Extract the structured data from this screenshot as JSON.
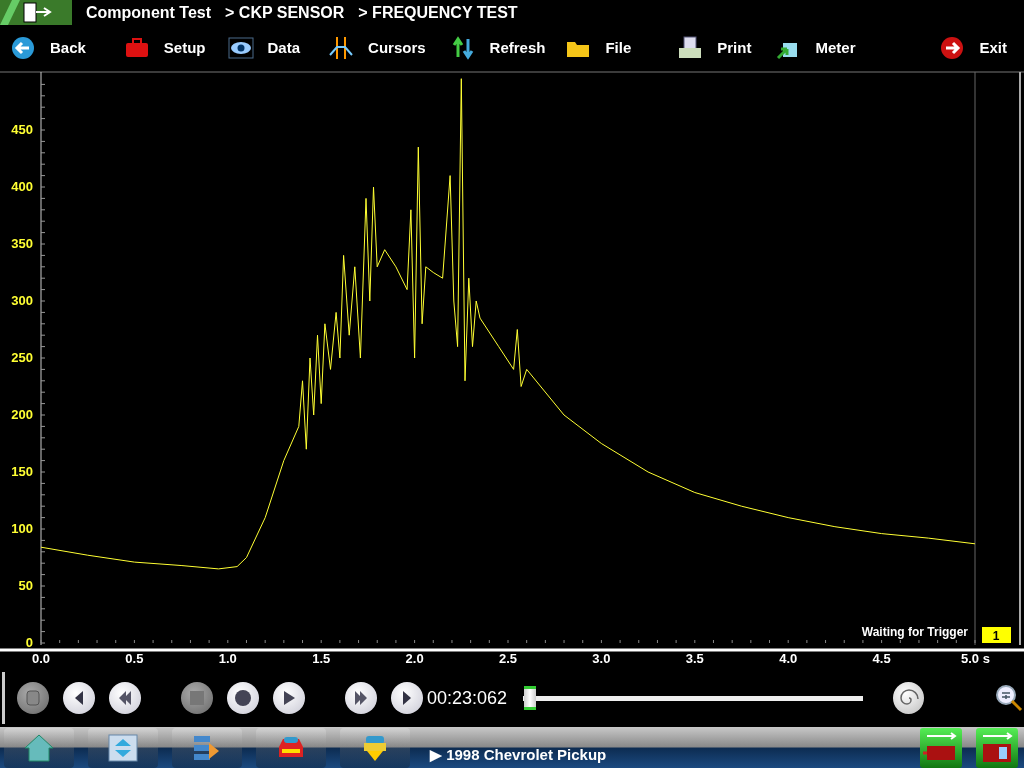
{
  "header": {
    "crumbs": [
      "Component Test",
      "> CKP SENSOR",
      "> FREQUENCY TEST"
    ]
  },
  "toolbar": [
    {
      "label": "Back"
    },
    {
      "label": "Setup"
    },
    {
      "label": "Data"
    },
    {
      "label": "Cursors"
    },
    {
      "label": "Refresh"
    },
    {
      "label": "File"
    },
    {
      "label": "Print"
    },
    {
      "label": "Meter"
    },
    {
      "label": "Exit"
    }
  ],
  "scope": {
    "status": "Waiting for Trigger",
    "channel": "1",
    "chart_data": {
      "type": "line",
      "xlim": [
        0,
        5
      ],
      "ylim": [
        0,
        500
      ],
      "xticks": [
        {
          "value": 0,
          "label": "0.0"
        },
        {
          "value": 0.5,
          "label": "0.5"
        },
        {
          "value": 1,
          "label": "1.0"
        },
        {
          "value": 1.5,
          "label": "1.5"
        },
        {
          "value": 2,
          "label": "2.0"
        },
        {
          "value": 2.5,
          "label": "2.5"
        },
        {
          "value": 3,
          "label": "3.0"
        },
        {
          "value": 3.5,
          "label": "3.5"
        },
        {
          "value": 4,
          "label": "4.0"
        },
        {
          "value": 4.5,
          "label": "4.5"
        },
        {
          "value": 5,
          "label": "5.0 s"
        }
      ],
      "yticks": [
        0,
        50,
        100,
        150,
        200,
        250,
        300,
        350,
        400,
        450
      ],
      "x": [
        0,
        0.25,
        0.5,
        0.75,
        0.95,
        1.05,
        1.1,
        1.2,
        1.3,
        1.38,
        1.4,
        1.42,
        1.44,
        1.46,
        1.48,
        1.5,
        1.52,
        1.55,
        1.58,
        1.6,
        1.62,
        1.65,
        1.68,
        1.71,
        1.74,
        1.76,
        1.78,
        1.8,
        1.84,
        1.9,
        1.96,
        1.98,
        2.0,
        2.02,
        2.04,
        2.06,
        2.1,
        2.15,
        2.19,
        2.21,
        2.23,
        2.25,
        2.27,
        2.29,
        2.31,
        2.33,
        2.35,
        2.45,
        2.53,
        2.55,
        2.57,
        2.6,
        2.8,
        3.0,
        3.25,
        3.5,
        3.75,
        4.0,
        4.25,
        4.5,
        4.75,
        5.0
      ],
      "series": [
        {
          "color": "#ffff33",
          "values": [
            84,
            77,
            71,
            68,
            65,
            67,
            75,
            110,
            160,
            190,
            230,
            170,
            250,
            200,
            270,
            210,
            280,
            240,
            290,
            250,
            340,
            270,
            330,
            250,
            390,
            300,
            400,
            330,
            345,
            330,
            310,
            380,
            250,
            435,
            280,
            330,
            325,
            320,
            410,
            300,
            260,
            495,
            230,
            320,
            260,
            300,
            285,
            260,
            240,
            275,
            225,
            240,
            200,
            175,
            150,
            132,
            120,
            110,
            102,
            96,
            92,
            87
          ]
        }
      ]
    }
  },
  "playback": {
    "buttons": [
      {
        "disabled": true
      },
      {
        "disabled": false
      },
      {
        "disabled": false
      },
      {
        "disabled": true
      },
      {
        "disabled": false
      },
      {
        "disabled": false
      },
      {
        "disabled": false
      },
      {
        "disabled": false
      }
    ],
    "time": "00:23:062",
    "level": 0.02
  },
  "taskbar": {
    "vehicle": "▶ 1998 Chevrolet Pickup"
  }
}
